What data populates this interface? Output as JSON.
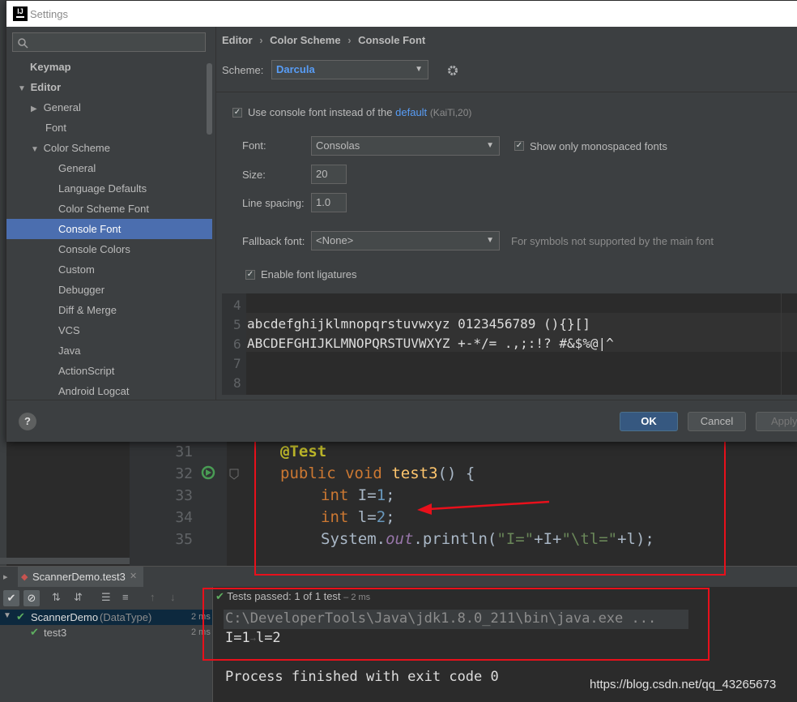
{
  "window": {
    "title": "Settings"
  },
  "search": {
    "placeholder": ""
  },
  "sidebar": {
    "items": [
      {
        "label": "Keymap"
      },
      {
        "label": "Editor"
      },
      {
        "label": "General"
      },
      {
        "label": "Font"
      },
      {
        "label": "Color Scheme"
      },
      {
        "label": "General"
      },
      {
        "label": "Language Defaults"
      },
      {
        "label": "Color Scheme Font"
      },
      {
        "label": "Console Font"
      },
      {
        "label": "Console Colors"
      },
      {
        "label": "Custom"
      },
      {
        "label": "Debugger"
      },
      {
        "label": "Diff & Merge"
      },
      {
        "label": "VCS"
      },
      {
        "label": "Java"
      },
      {
        "label": "ActionScript"
      },
      {
        "label": "Android Logcat"
      }
    ]
  },
  "breadcrumb": {
    "items": [
      "Editor",
      "Color Scheme",
      "Console Font"
    ],
    "separator": "›"
  },
  "scheme": {
    "label": "Scheme:",
    "value": "Darcula"
  },
  "console_font": {
    "use_console_font_prefix": "Use console font instead of the",
    "default_link": "default",
    "default_hint": "(KaiTi,20)",
    "font_label": "Font:",
    "font_value": "Consolas",
    "show_mono_label": "Show only monospaced fonts",
    "size_label": "Size:",
    "size_value": "20",
    "line_spacing_label": "Line spacing:",
    "line_spacing_value": "1.0",
    "fallback_label": "Fallback font:",
    "fallback_value": "<None>",
    "fallback_hint": "For symbols not supported by the main font",
    "ligatures_label": "Enable font ligatures"
  },
  "preview": {
    "line_numbers": [
      "4",
      "5",
      "6",
      "7",
      "8"
    ],
    "line5": "abcdefghijklmnopqrstuvwxyz 0123456789 (){}[]",
    "line6": "ABCDEFGHIJKLMNOPQRSTUVWXYZ +-*/= .,;:!? #&$%@|^"
  },
  "footer": {
    "help": "?",
    "ok": "OK",
    "cancel": "Cancel",
    "apply": "Apply"
  },
  "editor": {
    "line_numbers": [
      "31",
      "32",
      "33",
      "34",
      "35"
    ],
    "annotation": "@Test",
    "kw_public": "public",
    "kw_void": "void",
    "method": "test3",
    "method_rest": "() {",
    "kw_int": "int",
    "var_a": "I",
    "eq": "=",
    "num1": "1",
    "num2": "2",
    "semi": ";",
    "var_b": "l",
    "line35": "System.",
    "line35_out": "out",
    "line35_rest": ".println(",
    "line35_str1": "\"I=\"",
    "line35_mid": "+I+",
    "line35_str2": "\"\\tl=\"",
    "line35_end": "+l);"
  },
  "run": {
    "tab_label": "ScannerDemo.test3",
    "tree_root": "ScannerDemo",
    "tree_root_type": "(DataType)",
    "tree_root_time": "2 ms",
    "tree_child": "test3",
    "tree_child_time": "2 ms",
    "status_prefix": "Tests passed:",
    "status_count": "1",
    "status_of": "of 1 test",
    "status_time": "– 2 ms",
    "console_line1": "C:\\DeveloperTools\\Java\\jdk1.8.0_211\\bin\\java.exe ...",
    "console_line2a": "I=1",
    "console_line2b": "l=2",
    "console_line3": "Process finished with exit code 0",
    "watermark": "https://blog.csdn.net/qq_43265673"
  },
  "colors": {
    "accent": "#4b6eaf",
    "annotation_red": "#e8101b",
    "ok_button": "#365880",
    "link": "#589df6"
  }
}
